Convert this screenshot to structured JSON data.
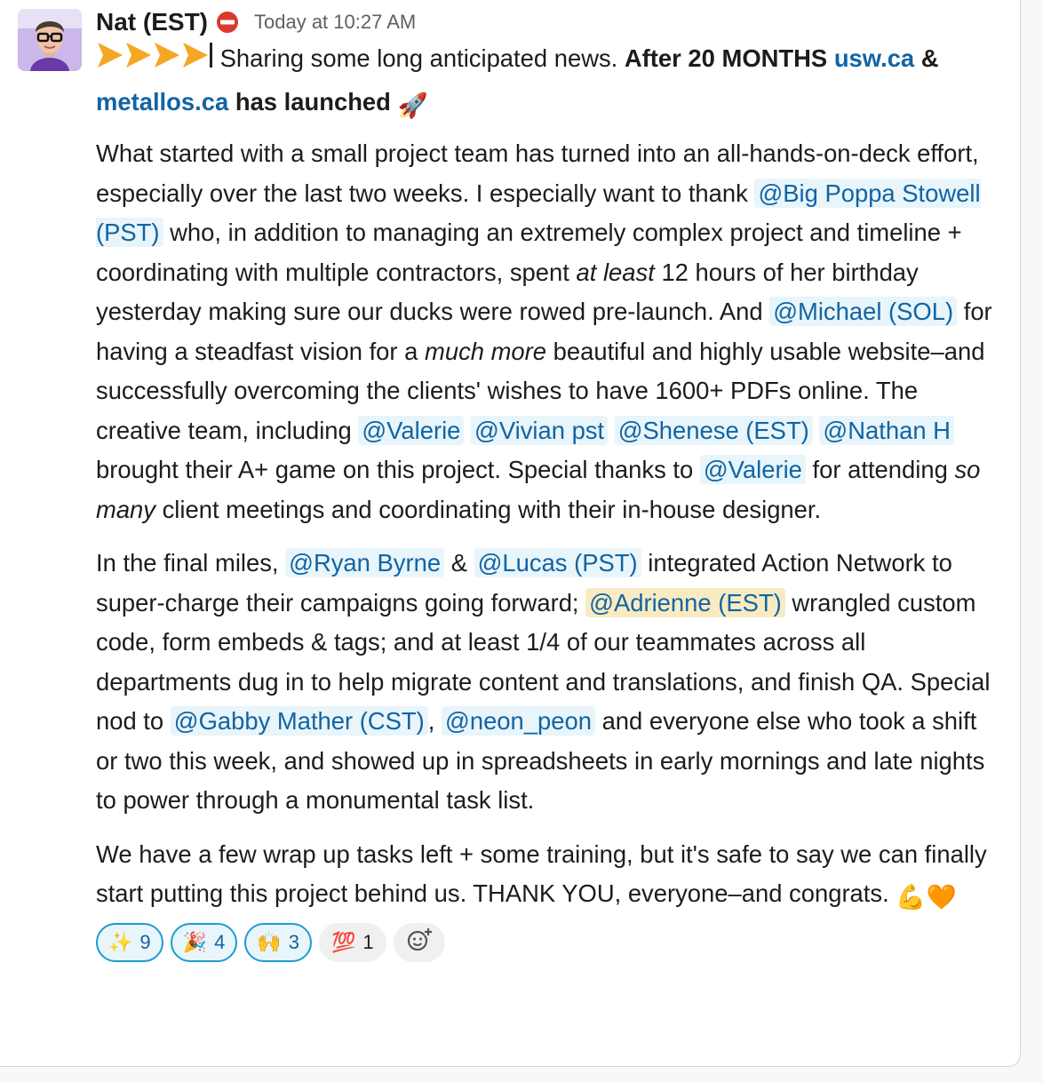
{
  "message": {
    "author": "Nat (EST)",
    "timestamp": "Today at 10:27 AM",
    "status_icon": "no-entry-icon",
    "line1": {
      "arrows": "▶▶▶▶",
      "text1": "Sharing some long anticipated news.",
      "bold1": "After 20 MONTHS",
      "link1": "usw.ca",
      "amp": "&",
      "link2": "metallos.ca",
      "bold2": "has launched",
      "rocket": "🚀"
    },
    "p1": {
      "t1": "What started with a small project team has turned into an all-hands-on-deck effort, especially over the last two weeks. I especially want to thank",
      "m1": "@Big Poppa Stowell (PST)",
      "t2": "who, in addition to managing an extremely complex project and timeline + coordinating with multiple contractors, spent",
      "i1": "at least",
      "t3": "12 hours of her birthday yesterday making sure our ducks were rowed pre-launch. And",
      "m2": "@Michael (SOL)",
      "t4": "for having a steadfast vision for a",
      "i2": "much more",
      "t5": "beautiful and highly usable website–and successfully overcoming the clients' wishes to have 1600+ PDFs online. The creative team, including",
      "m3": "@Valerie",
      "m4": "@Vivian pst",
      "m5": "@Shenese (EST)",
      "m6": "@Nathan H",
      "t6": "brought their A+ game on this project. Special thanks to",
      "m7": "@Valerie",
      "t7": "for attending",
      "i3": "so many",
      "t8": "client meetings and coordinating with their in-house designer."
    },
    "p2": {
      "t1": "In the final miles,",
      "m1": "@Ryan Byrne",
      "t2": "&",
      "m2": "@Lucas (PST)",
      "t3": "integrated Action Network to super-charge their campaigns going forward;",
      "m3": "@Adrienne (EST)",
      "t4": "wrangled custom code, form embeds & tags; and at least 1/4 of our teammates across all departments dug in to help migrate content and translations, and finish QA. Special nod to",
      "m4": "@Gabby Mather (CST)",
      "comma": ",",
      "m5": "@neon_peon",
      "t5": "and everyone else who took a shift or two this week, and showed up in spreadsheets in early mornings and late nights to power through a monumental task list."
    },
    "p3": {
      "t1": "We have a few wrap up tasks left + some training, but it's safe to say we can finally start putting this project behind us. THANK YOU, everyone–and congrats.",
      "emoji1": "💪",
      "emoji2": "🧡"
    },
    "reactions": [
      {
        "emoji": "✨",
        "count": "9",
        "active": true
      },
      {
        "emoji": "🎉",
        "count": "4",
        "active": true
      },
      {
        "emoji": "🙌",
        "count": "3",
        "active": true
      },
      {
        "emoji": "💯",
        "count": "1",
        "active": false
      }
    ]
  },
  "colors": {
    "link": "#1264a3",
    "mention_bg": "#e8f5fa",
    "self_mention_bg": "#f8ebc2",
    "reaction_border": "#1d9bd1",
    "arrow": "#f5a623",
    "status_red": "#d93a2b"
  }
}
